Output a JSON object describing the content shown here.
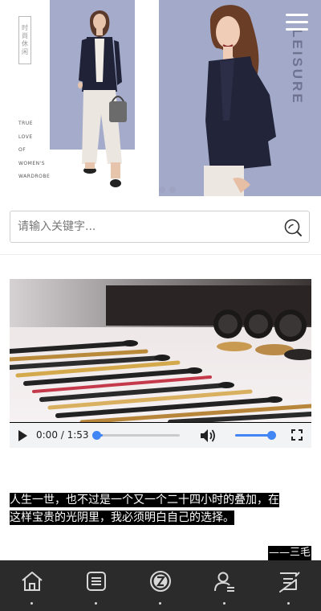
{
  "hero": {
    "vertical_text": "时尚休闲",
    "tagline_lines": [
      "TRUE",
      "LOVE",
      "OF",
      "WOMEN'S",
      "WARDROBE"
    ],
    "side_word": "LEISURE",
    "slide_count": 3,
    "active_slide": 1,
    "colors": {
      "panel": "#a4abcb",
      "coat": "#202338",
      "pants": "#e9e4dd"
    }
  },
  "search": {
    "placeholder": "请输入关键字...",
    "value": "",
    "icon": "search-icon"
  },
  "video": {
    "current_time": "0:00",
    "duration": "1:53",
    "time_display": "0:00 / 1:53",
    "progress": 0.0,
    "volume": 1.0,
    "accent_color": "#4285f4"
  },
  "quote": {
    "line1": "人生一世，也不过是一个又一个二十四小时的叠加，在",
    "line2": "这样宝贵的光阴里，我必须明白自己的选择。",
    "author": "——三毛"
  },
  "bottom_nav": {
    "items": [
      {
        "icon": "home-icon"
      },
      {
        "icon": "list-icon"
      },
      {
        "icon": "brand-icon"
      },
      {
        "icon": "user-icon"
      },
      {
        "icon": "message-icon"
      }
    ],
    "background": "#2b2b2b"
  }
}
